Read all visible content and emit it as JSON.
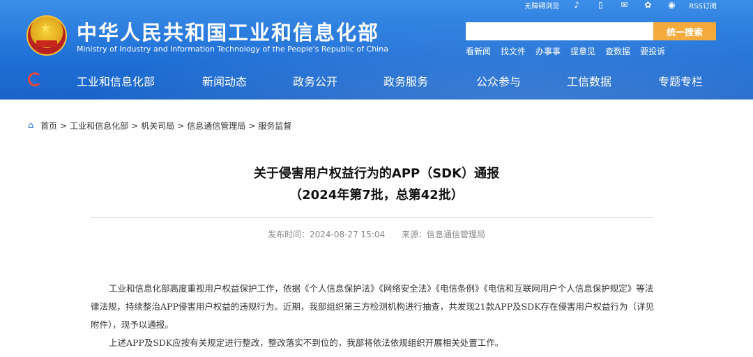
{
  "header": {
    "org_name_cn": "中华人民共和国工业和信息化部",
    "org_name_en": "Ministry of Industry and Information Technology of the People's Republic of China",
    "topbar": {
      "accessibility": "无障碍浏览",
      "rss": "RSS订阅"
    },
    "search": {
      "placeholder": "",
      "button_label": "统一搜索"
    },
    "quicklinks": [
      "看新闻",
      "找文件",
      "办事事",
      "提意见",
      "查数据",
      "要投诉"
    ],
    "nav": [
      "工业和信息化部",
      "新闻动态",
      "政务公开",
      "政务服务",
      "公众参与",
      "工信数据",
      "专题专栏"
    ]
  },
  "breadcrumb": [
    "首页",
    "工业和信息化部",
    "机关司局",
    "信息通信管理局",
    "服务监督"
  ],
  "article": {
    "title_line1": "关于侵害用户权益行为的APP（SDK）通报",
    "title_line2": "（2024年第7批，总第42批）",
    "publish_time": "发布时间：2024-08-27 15:04",
    "source": "来源：信息通信管理局",
    "paragraphs": [
      "工业和信息化部高度重视用户权益保护工作，依据《个人信息保护法》《网络安全法》《电信条例》《电信和互联网用户个人信息保护规定》等法律法规，持续整治APP侵害用户权益的违规行为。近期，我部组织第三方检测机构进行抽查，共发现21款APP及SDK存在侵害用户权益行为（详见附件），现予以通报。",
      "上述APP及SDK应按有关规定进行整改，整改落实不到位的，我部将依法依规组织开展相关处置工作。"
    ]
  }
}
